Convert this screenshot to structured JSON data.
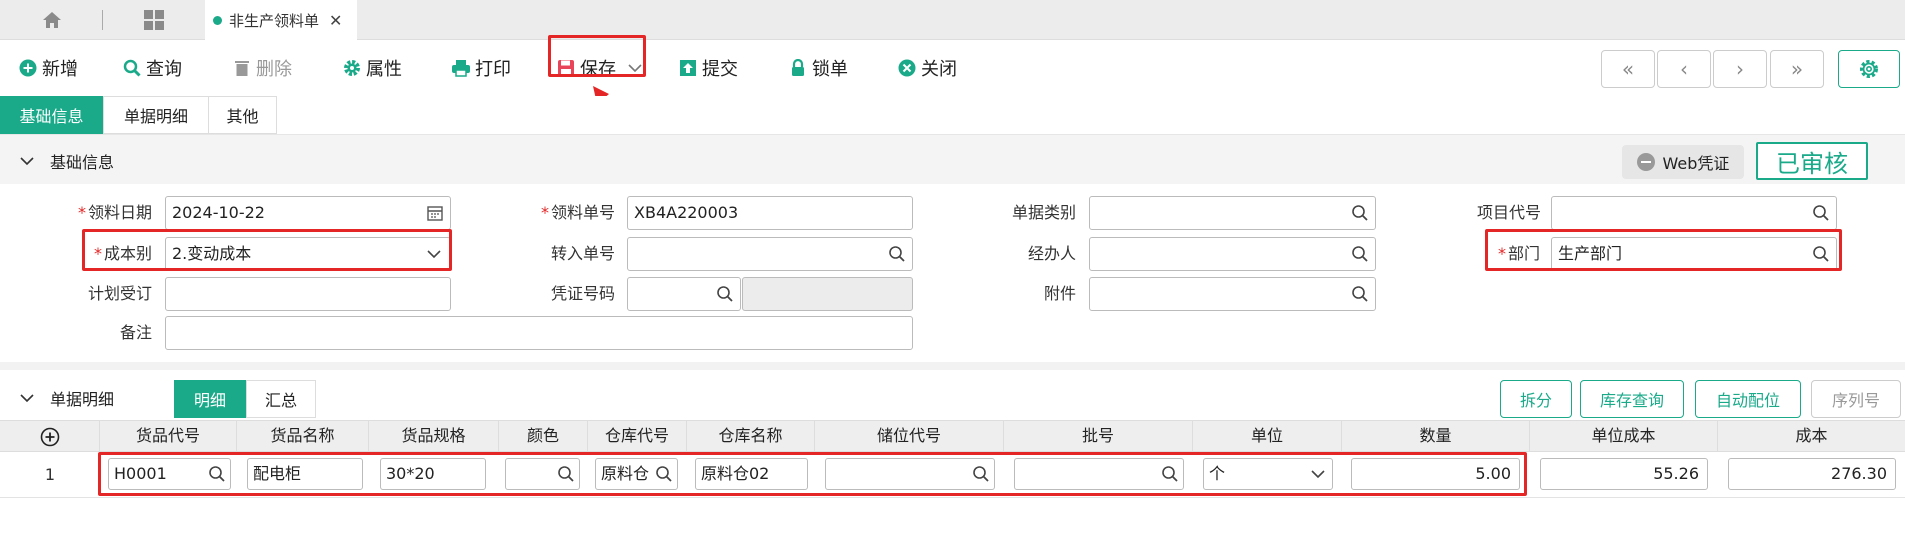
{
  "tabs": {
    "active_label": "非生产领料单"
  },
  "toolbar": {
    "new": "新增",
    "query": "查询",
    "delete": "删除",
    "props": "属性",
    "print": "打印",
    "save": "保存",
    "submit": "提交",
    "lock": "锁单",
    "close": "关闭"
  },
  "subtabs": [
    "基础信息",
    "单据明细",
    "其他"
  ],
  "basic": {
    "section_title": "基础信息",
    "web_voucher": "Web凭证",
    "status": "已审核",
    "fields": {
      "date_label": "领料日期",
      "date_value": "2024-10-22",
      "orderno_label": "领料单号",
      "orderno_value": "XB4A220003",
      "doctype_label": "单据类别",
      "doctype_value": "",
      "project_label": "项目代号",
      "project_value": "",
      "costtype_label": "成本别",
      "costtype_value": "2.变动成本",
      "transfer_label": "转入单号",
      "transfer_value": "",
      "handler_label": "经办人",
      "handler_value": "",
      "dept_label": "部门",
      "dept_value": "生产部门",
      "plan_label": "计划受订",
      "plan_value": "",
      "voucher_label": "凭证号码",
      "voucher_value": "",
      "attach_label": "附件",
      "attach_value": "",
      "remark_label": "备注",
      "remark_value": ""
    }
  },
  "detail": {
    "section_title": "单据明细",
    "tab_detail": "明细",
    "tab_summary": "汇总",
    "btn_split": "拆分",
    "btn_stock": "库存查询",
    "btn_auto": "自动配位",
    "btn_serial": "序列号",
    "columns": [
      "货品代号",
      "货品名称",
      "货品规格",
      "颜色",
      "仓库代号",
      "仓库名称",
      "储位代号",
      "批号",
      "单位",
      "数量",
      "单位成本",
      "成本"
    ],
    "rows": [
      {
        "no": "1",
        "code": "H0001",
        "name": "配电柜",
        "spec": "30*20",
        "color": "",
        "wh_code": "原料仓",
        "wh_name": "原料仓02",
        "loc": "",
        "batch": "",
        "unit": "个",
        "qty": "5.00",
        "unit_cost": "55.26",
        "cost": "276.30"
      }
    ]
  }
}
